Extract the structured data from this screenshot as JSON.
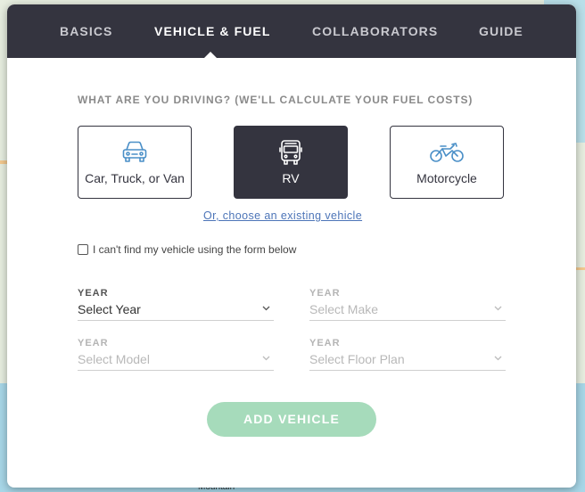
{
  "tabs": [
    {
      "label": "BASICS",
      "active": false
    },
    {
      "label": "VEHICLE & FUEL",
      "active": true
    },
    {
      "label": "COLLABORATORS",
      "active": false
    },
    {
      "label": "GUIDE",
      "active": false
    }
  ],
  "question": "WHAT ARE YOU DRIVING? (WE'LL CALCULATE YOUR FUEL COSTS)",
  "vehicle_types": [
    {
      "label": "Car, Truck, or Van",
      "icon": "car-icon",
      "selected": false
    },
    {
      "label": "RV",
      "icon": "rv-icon",
      "selected": true
    },
    {
      "label": "Motorcycle",
      "icon": "motorcycle-icon",
      "selected": false
    }
  ],
  "existing_vehicle_link": "Or, choose an existing vehicle",
  "cant_find_label": "I can't find my vehicle using the form below",
  "fields": {
    "year": {
      "label": "YEAR",
      "value": "Select Year"
    },
    "make": {
      "label": "YEAR",
      "value": "Select Make"
    },
    "model": {
      "label": "YEAR",
      "value": "Select Model"
    },
    "floor_plan": {
      "label": "YEAR",
      "value": "Select Floor Plan"
    }
  },
  "add_button": "ADD VEHICLE",
  "map_label": "Mountain",
  "colors": {
    "dark": "#34343f",
    "accent_green": "#a6dbbb",
    "link": "#4d75b8"
  }
}
